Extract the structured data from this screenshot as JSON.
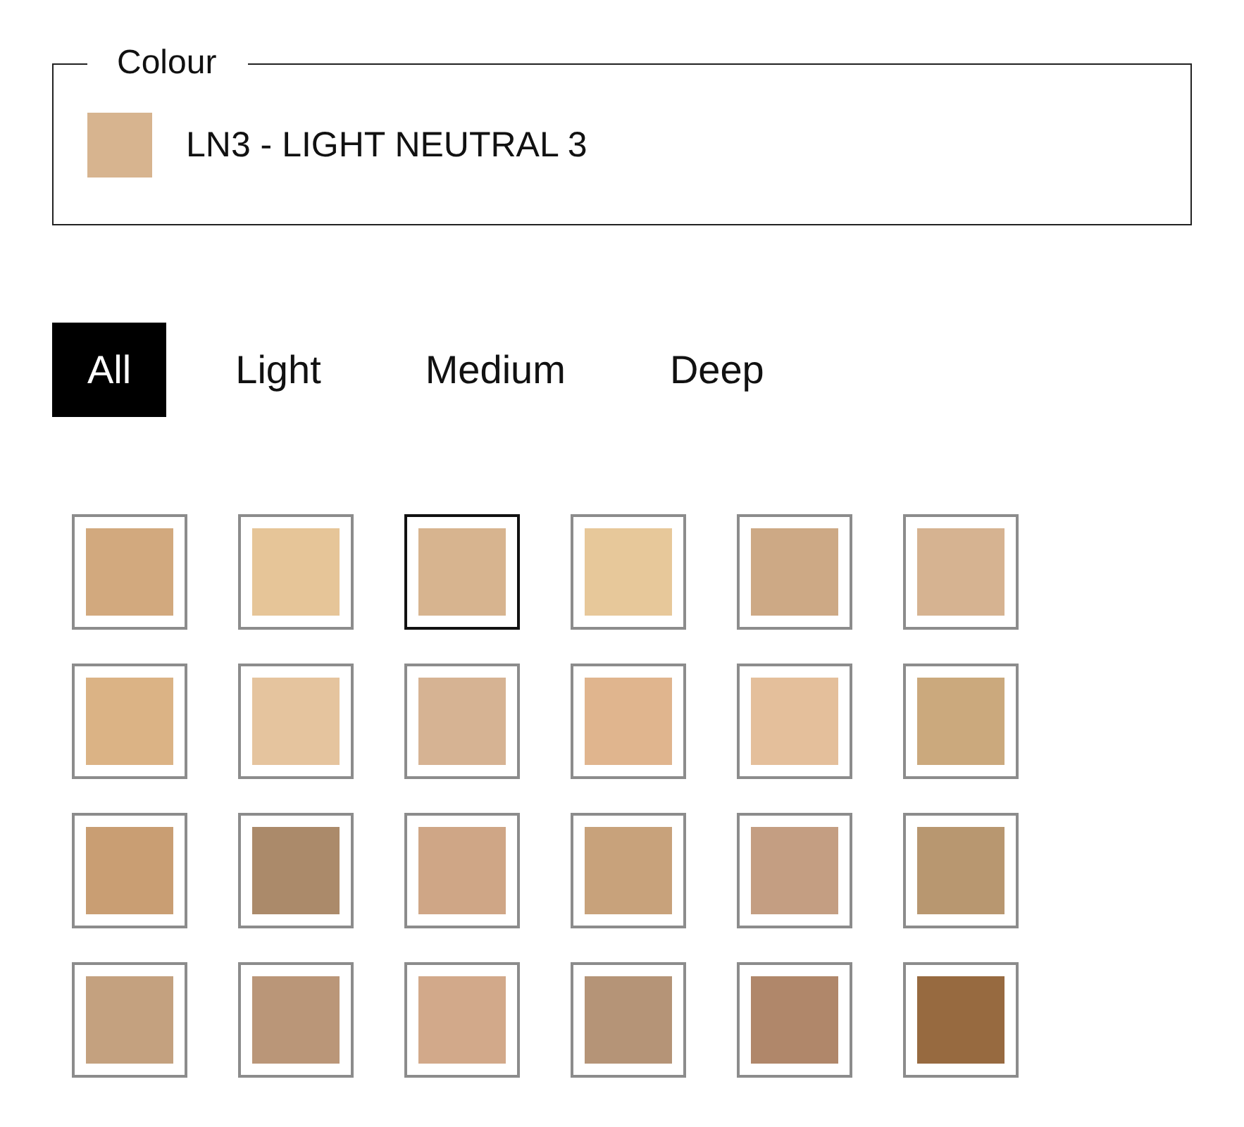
{
  "colour_field": {
    "legend": "Colour",
    "color": "#d7b48f",
    "value": "LN3 - LIGHT NEUTRAL 3"
  },
  "tabs": [
    {
      "label": "All",
      "selected": true
    },
    {
      "label": "Light",
      "selected": false
    },
    {
      "label": "Medium",
      "selected": false
    },
    {
      "label": "Deep",
      "selected": false
    }
  ],
  "shades": [
    {
      "color": "#d2a97e",
      "selected": false
    },
    {
      "color": "#e6c598",
      "selected": false
    },
    {
      "color": "#d7b48f",
      "selected": true
    },
    {
      "color": "#e7c89a",
      "selected": false
    },
    {
      "color": "#cda985",
      "selected": false
    },
    {
      "color": "#d6b391",
      "selected": false
    },
    {
      "color": "#dbb385",
      "selected": false
    },
    {
      "color": "#e5c49e",
      "selected": false
    },
    {
      "color": "#d6b393",
      "selected": false
    },
    {
      "color": "#e0b58e",
      "selected": false
    },
    {
      "color": "#e4bf9b",
      "selected": false
    },
    {
      "color": "#cba97d",
      "selected": false
    },
    {
      "color": "#c99e73",
      "selected": false
    },
    {
      "color": "#ab8a6a",
      "selected": false
    },
    {
      "color": "#cfa686",
      "selected": false
    },
    {
      "color": "#c8a27b",
      "selected": false
    },
    {
      "color": "#c49e82",
      "selected": false
    },
    {
      "color": "#b89770",
      "selected": false
    },
    {
      "color": "#c4a17f",
      "selected": false
    },
    {
      "color": "#ba9678",
      "selected": false
    },
    {
      "color": "#d2a98a",
      "selected": false
    },
    {
      "color": "#b59477",
      "selected": false
    },
    {
      "color": "#b0876a",
      "selected": false
    },
    {
      "color": "#976a40",
      "selected": false
    }
  ]
}
